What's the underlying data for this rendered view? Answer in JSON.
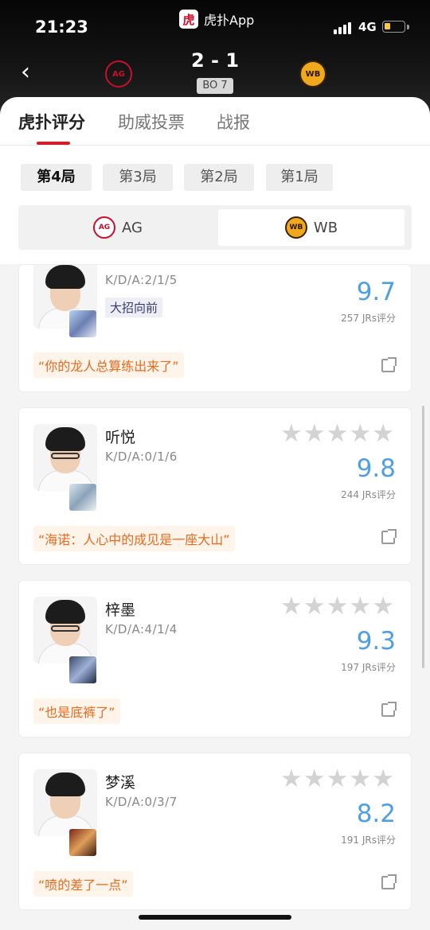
{
  "status_bar": {
    "time": "21:23",
    "network": "4G",
    "battery_color": "#f6c93e"
  },
  "app": {
    "logo_char": "虎",
    "name": "虎扑App"
  },
  "match": {
    "score": "2 - 1",
    "format": "BO 7",
    "team_left": {
      "name": "AG",
      "logo_text": "AG",
      "color": "#c8102e"
    },
    "team_right": {
      "name": "WB",
      "logo_text": "WB",
      "color": "#f0a81c"
    }
  },
  "nav": {
    "back_icon": "‹"
  },
  "tabs": [
    "虎扑评分",
    "助威投票",
    "战报"
  ],
  "games": [
    "第4局",
    "第3局",
    "第2局",
    "第1局"
  ],
  "players": [
    {
      "kda": "K/D/A:2/1/5",
      "tag": "大招向前",
      "score": "9.7",
      "votes": "257 JRs评分",
      "quote": "“你的龙人总算练出来了”"
    },
    {
      "name": "听悦",
      "kda": "K/D/A:0/1/6",
      "stars": "★★★★★",
      "score": "9.8",
      "votes": "244 JRs评分",
      "quote": "“海诺：人心中的成见是一座大山”"
    },
    {
      "name": "梓墨",
      "kda": "K/D/A:4/1/4",
      "stars": "★★★★★",
      "score": "9.3",
      "votes": "197 JRs评分",
      "quote": "“也是底裤了”"
    },
    {
      "name": "梦溪",
      "kda": "K/D/A:0/3/7",
      "stars": "★★★★★",
      "score": "8.2",
      "votes": "191 JRs评分",
      "quote": "“喷的差了一点”"
    }
  ],
  "colors": {
    "accent": "#d0202a",
    "score_blue": "#4f9fe2",
    "quote_orange": "#ea6a1f"
  }
}
